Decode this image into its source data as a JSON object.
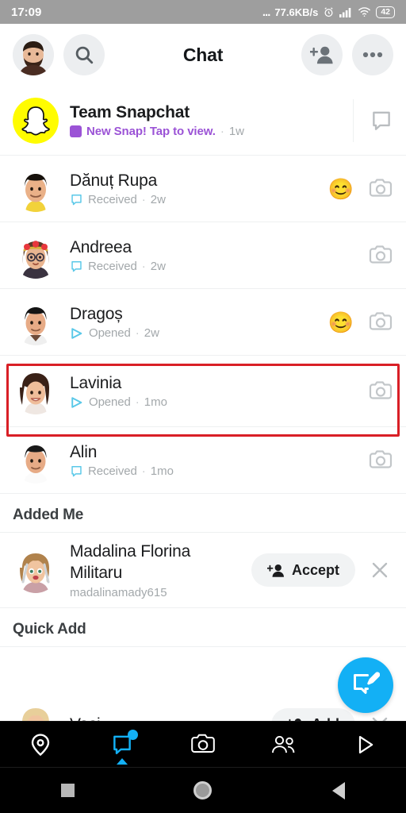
{
  "statusbar": {
    "time": "17:09",
    "dots": "...",
    "network_speed": "77.6KB/s",
    "battery": "42",
    "icons": [
      "alarm-clock-icon",
      "signal-bars-icon",
      "wifi-icon",
      "battery-icon"
    ]
  },
  "header": {
    "title": "Chat",
    "avatar_name": "profile-avatar",
    "search_icon": "search-icon",
    "add_friend_icon": "add-friend-icon",
    "more_icon": "more-options-icon"
  },
  "chats": [
    {
      "name": "Team Snapchat",
      "name_bold": true,
      "status": "New Snap! Tap to view.",
      "status_type": "new-snap",
      "status_color": "#9b53d6",
      "time": "1w",
      "emoji": "",
      "right_icon": "chat-bubble-icon",
      "avatar": "snapchat-ghost-logo",
      "highlighted": false
    },
    {
      "name": "Dănuț Rupa",
      "name_bold": false,
      "status": "Received",
      "status_type": "received",
      "status_color": "#a3a8ab",
      "time": "2w",
      "emoji": "😊",
      "right_icon": "camera-icon",
      "avatar": "bitmoji-danut",
      "highlighted": false
    },
    {
      "name": "Andreea",
      "name_bold": false,
      "status": "Received",
      "status_type": "received",
      "status_color": "#a3a8ab",
      "time": "2w",
      "emoji": "",
      "right_icon": "camera-icon",
      "avatar": "bitmoji-andreea",
      "highlighted": false
    },
    {
      "name": "Dragoș",
      "name_bold": false,
      "status": "Opened",
      "status_type": "opened",
      "status_color": "#a3a8ab",
      "time": "2w",
      "emoji": "😊",
      "right_icon": "camera-icon",
      "avatar": "bitmoji-dragos",
      "highlighted": false
    },
    {
      "name": "Lavinia",
      "name_bold": false,
      "status": "Opened",
      "status_type": "opened",
      "status_color": "#a3a8ab",
      "time": "1mo",
      "emoji": "",
      "right_icon": "camera-icon",
      "avatar": "bitmoji-lavinia",
      "highlighted": true
    },
    {
      "name": "Alin",
      "name_bold": false,
      "status": "Received",
      "status_type": "received",
      "status_color": "#a3a8ab",
      "time": "1mo",
      "emoji": "",
      "right_icon": "camera-icon",
      "avatar": "bitmoji-alin",
      "highlighted": false
    }
  ],
  "added_me": {
    "title": "Added Me",
    "requests": [
      {
        "name": "Madalina Florina Militaru",
        "username": "madalinamady615",
        "accept_label": "Accept",
        "accept_icon": "add-friend-icon",
        "dismiss_icon": "close-icon"
      }
    ]
  },
  "quick_add": {
    "title": "Quick Add",
    "items": [
      {
        "name": "Vasi",
        "add_label": "Add",
        "add_icon": "add-friend-icon",
        "dismiss_icon": "close-icon"
      }
    ]
  },
  "fab": {
    "icon": "new-chat-icon",
    "color": "#13b0f5"
  },
  "bottom_nav": {
    "items": [
      {
        "icon": "map-pin-icon",
        "label": "Map",
        "active": false,
        "badge": false
      },
      {
        "icon": "chat-icon",
        "label": "Chat",
        "active": true,
        "badge": true
      },
      {
        "icon": "camera-icon",
        "label": "Camera",
        "active": false,
        "badge": false
      },
      {
        "icon": "friends-icon",
        "label": "Friends",
        "active": false,
        "badge": false
      },
      {
        "icon": "play-icon",
        "label": "Spotlight",
        "active": false,
        "badge": false
      }
    ],
    "active_color": "#13b0f5"
  },
  "system_nav": {
    "items": [
      {
        "icon": "recents-square-icon",
        "label": "Recents"
      },
      {
        "icon": "home-circle-icon",
        "label": "Home"
      },
      {
        "icon": "back-triangle-icon",
        "label": "Back"
      }
    ]
  },
  "annotation": {
    "color": "#d91f26",
    "target": "Lavinia"
  }
}
